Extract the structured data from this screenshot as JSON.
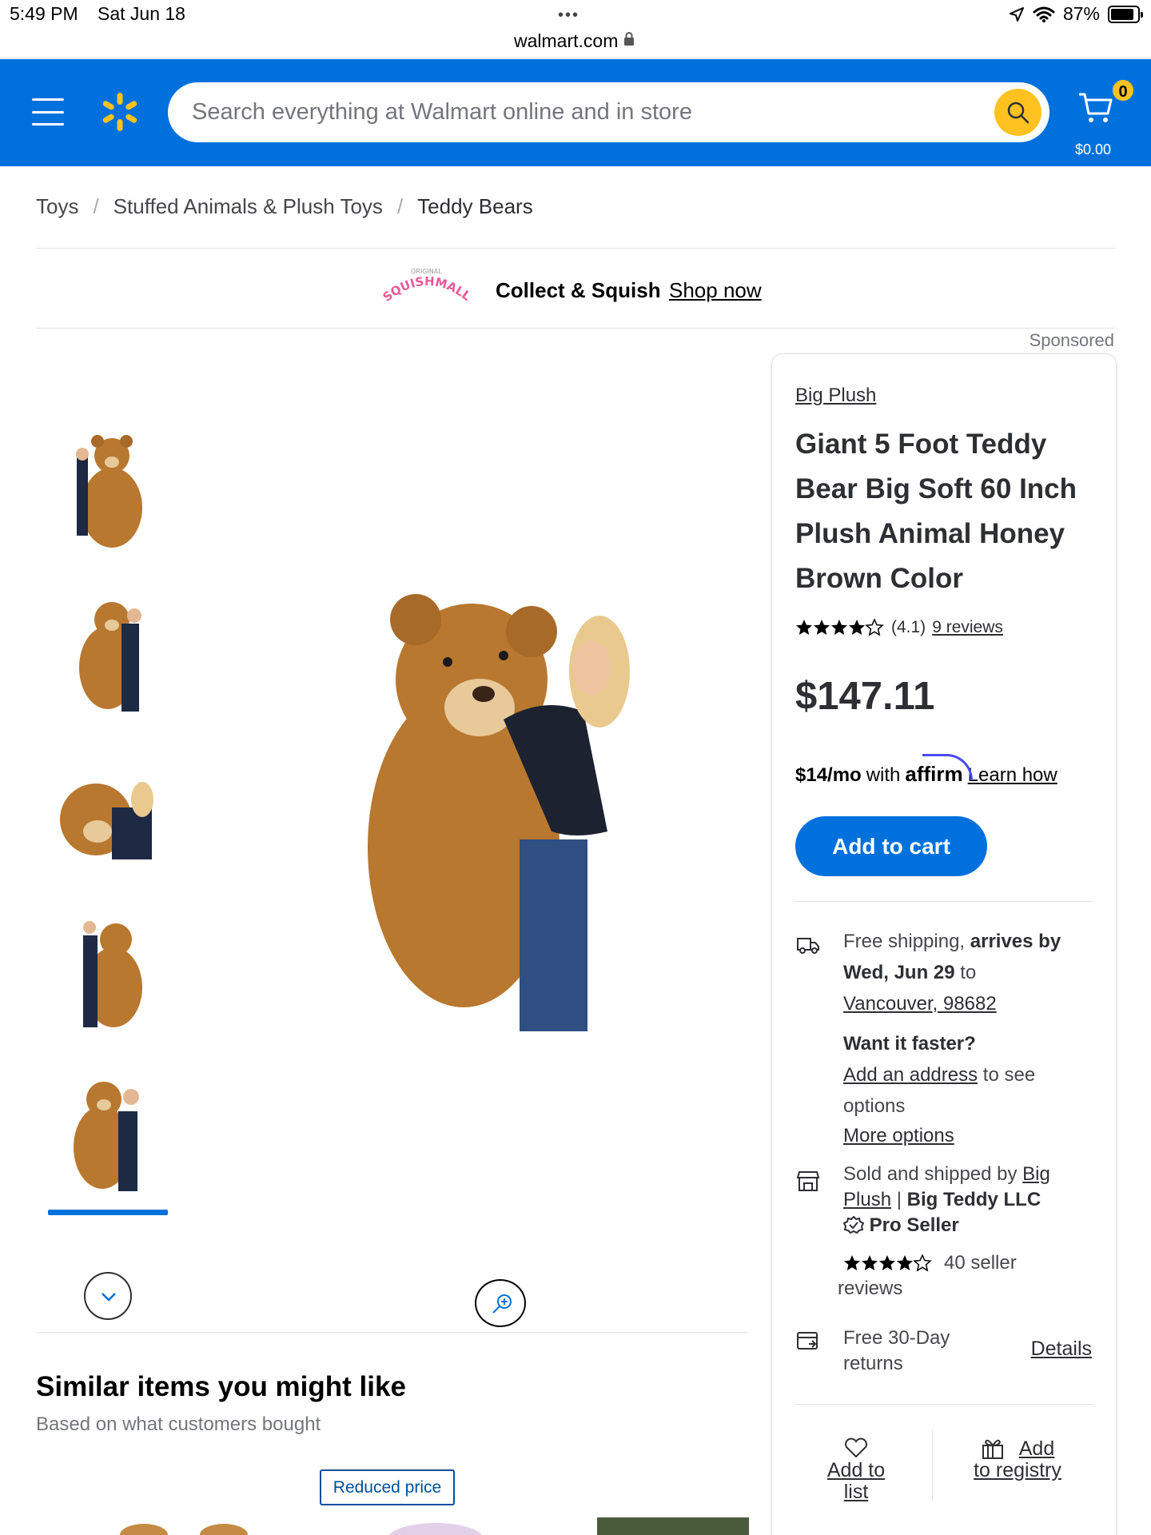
{
  "status_bar": {
    "time": "5:49 PM",
    "date": "Sat Jun 18",
    "dots": "•••",
    "url": "walmart.com",
    "battery": "87%"
  },
  "header": {
    "search_placeholder": "Search everything at Walmart online and in store",
    "cart_count": "0",
    "cart_total": "$0.00",
    "accent_color": "#0071dc",
    "spark_color": "#ffc220"
  },
  "breadcrumb": {
    "items": [
      "Toys",
      "Stuffed Animals & Plush Toys",
      "Teddy Bears"
    ],
    "separator": "/"
  },
  "ad": {
    "logo_text": "SQUISHMALLOWS",
    "logo_small": "ORIGINAL",
    "tagline": "Collect & Squish",
    "link": "Shop now"
  },
  "sponsored_label": "Sponsored",
  "similar": {
    "title": "Similar items you might like",
    "subtitle": "Based on what customers bought",
    "badge": "Reduced price"
  },
  "product": {
    "brand": "Big Plush",
    "title": "Giant 5 Foot Teddy Bear Big Soft 60 Inch Plush Animal Honey Brown Color",
    "rating_value": 4.1,
    "rating_text": "(4.1)",
    "reviews_link": "9 reviews",
    "price": "$147.11",
    "affirm_amount": "$14/mo",
    "affirm_with": "with",
    "affirm_brand": "affirm",
    "affirm_link": "Learn how",
    "add_to_cart": "Add to cart"
  },
  "shipping": {
    "free_shipping": "Free shipping,",
    "arrives_by": "arrives by",
    "date": "Wed, Jun 29",
    "to": "to",
    "location": "Vancouver, 98682",
    "want_faster": "Want it faster?",
    "add_address": "Add an address",
    "to_see": "to see",
    "options": "options",
    "more_options": "More options"
  },
  "seller": {
    "sold_by": "Sold and shipped by",
    "seller_link_1": "Big",
    "seller_link_2": "Plush",
    "seller_pipe": "|",
    "seller_name": "Big Teddy LLC",
    "pro_seller": "Pro Seller",
    "seller_rating": 4.5,
    "seller_reviews_1": "40 seller",
    "seller_reviews_2": "reviews"
  },
  "returns": {
    "line1": "Free 30-Day",
    "line2": "returns",
    "details": "Details"
  },
  "actions": {
    "add_to_list_1": "Add to",
    "add_to_list_2": "list",
    "add_to_registry_1": "Add",
    "add_to_registry_2": "to registry"
  }
}
